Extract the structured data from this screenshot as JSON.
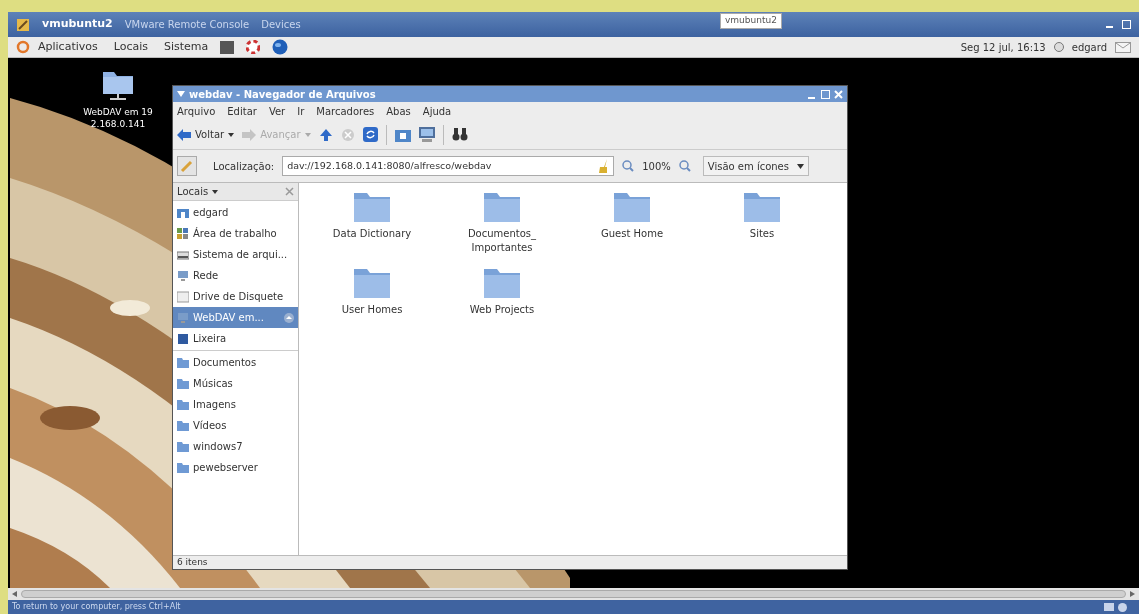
{
  "vm_window": {
    "title": "vmubuntu2",
    "subtitle": "VMware Remote Console",
    "menus": [
      "Devices"
    ],
    "tooltip": "vmubuntu2"
  },
  "panel": {
    "menus": [
      "Aplicativos",
      "Locais",
      "Sistema"
    ],
    "clock": "Seg 12 jul, 16:13",
    "user": "edgard"
  },
  "desktop_icons": [
    {
      "label": "WebDAV em 192.168.0.141"
    }
  ],
  "file_manager": {
    "title": "webdav - Navegador de Arquivos",
    "menus": [
      "Arquivo",
      "Editar",
      "Ver",
      "Ir",
      "Marcadores",
      "Abas",
      "Ajuda"
    ],
    "toolbar": [
      {
        "kind": "back",
        "label": "Voltar",
        "disabled": false
      },
      {
        "kind": "forward",
        "label": "Avançar",
        "disabled": true
      }
    ],
    "location": {
      "label": "Localização:",
      "value": "dav://192.168.0.141:8080/alfresco/webdav",
      "zoom": "100%",
      "view": "Visão em ícones"
    },
    "sidebar": {
      "header": "Locais",
      "groups": [
        [
          {
            "kind": "home",
            "label": "edgard",
            "selected": false
          },
          {
            "kind": "desktop",
            "label": "Área de trabalho",
            "selected": false
          },
          {
            "kind": "drive",
            "label": "Sistema de arqui...",
            "selected": false
          },
          {
            "kind": "network",
            "label": "Rede",
            "selected": false
          },
          {
            "kind": "floppy",
            "label": "Drive de Disquete",
            "selected": false
          },
          {
            "kind": "network",
            "label": "WebDAV em...",
            "selected": true
          },
          {
            "kind": "trash",
            "label": "Lixeira",
            "selected": false
          }
        ],
        [
          {
            "kind": "folder",
            "label": "Documentos",
            "selected": false
          },
          {
            "kind": "folder",
            "label": "Músicas",
            "selected": false
          },
          {
            "kind": "folder",
            "label": "Imagens",
            "selected": false
          },
          {
            "kind": "folder",
            "label": "Vídeos",
            "selected": false
          },
          {
            "kind": "folder",
            "label": "windows7",
            "selected": false
          },
          {
            "kind": "folder",
            "label": "pewebserver",
            "selected": false
          }
        ]
      ]
    },
    "files": [
      "Data Dictionary",
      "Documentos_ Importantes",
      "Guest Home",
      "Sites",
      "User Homes",
      "Web Projects"
    ],
    "status": "6 itens"
  },
  "status_bar": "To return to your computer, press Ctrl+Alt"
}
